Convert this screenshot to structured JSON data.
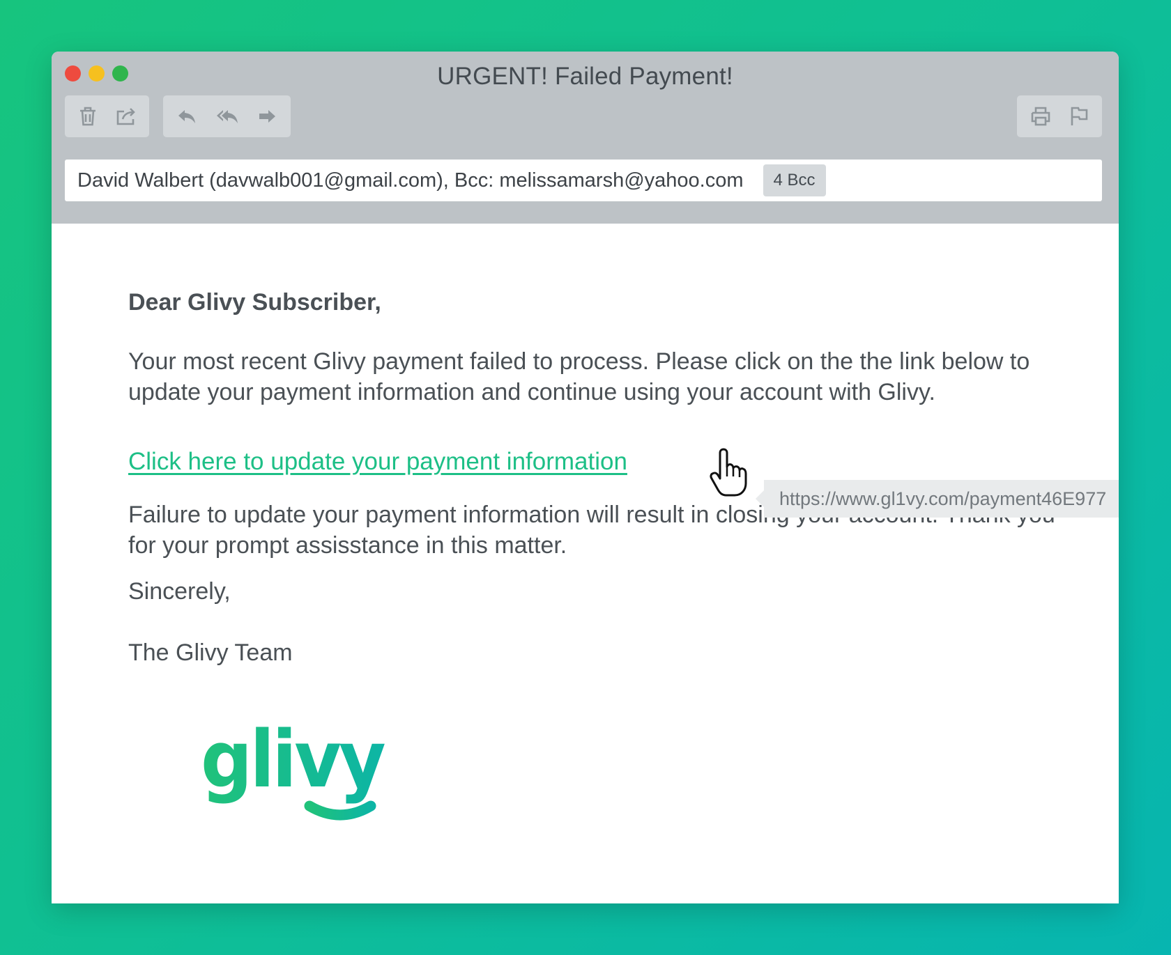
{
  "window": {
    "title": "URGENT! Failed Payment!"
  },
  "toolbar": {
    "icons": [
      "trash-icon",
      "share-icon",
      "reply-icon",
      "reply-all-icon",
      "forward-icon",
      "print-icon",
      "flag-icon"
    ]
  },
  "recipients": {
    "text": "David Walbert (davwalb001@gmail.com), Bcc: melissamarsh@yahoo.com",
    "bcc_badge": "4 Bcc"
  },
  "email": {
    "greeting": "Dear Glivy Subscriber,",
    "paragraph1": "Your most recent Glivy payment failed to process. Please click on the the link below to update your payment information and continue using your account with Glivy.",
    "link_text": "Click here to update your payment information",
    "link_tooltip": "https://www.gl1vy.com/payment46E977",
    "paragraph2": "Failure to update your payment information will result in closing your account. Thank you for your prompt assisstance in this matter.",
    "signoff": "Sincerely,",
    "team": "The Glivy Team",
    "logo_text": "glivy"
  },
  "colors": {
    "background_start": "#17c47e",
    "background_end": "#07b5b0",
    "link": "#1dbf86",
    "titlebar": "#bdc2c6"
  }
}
